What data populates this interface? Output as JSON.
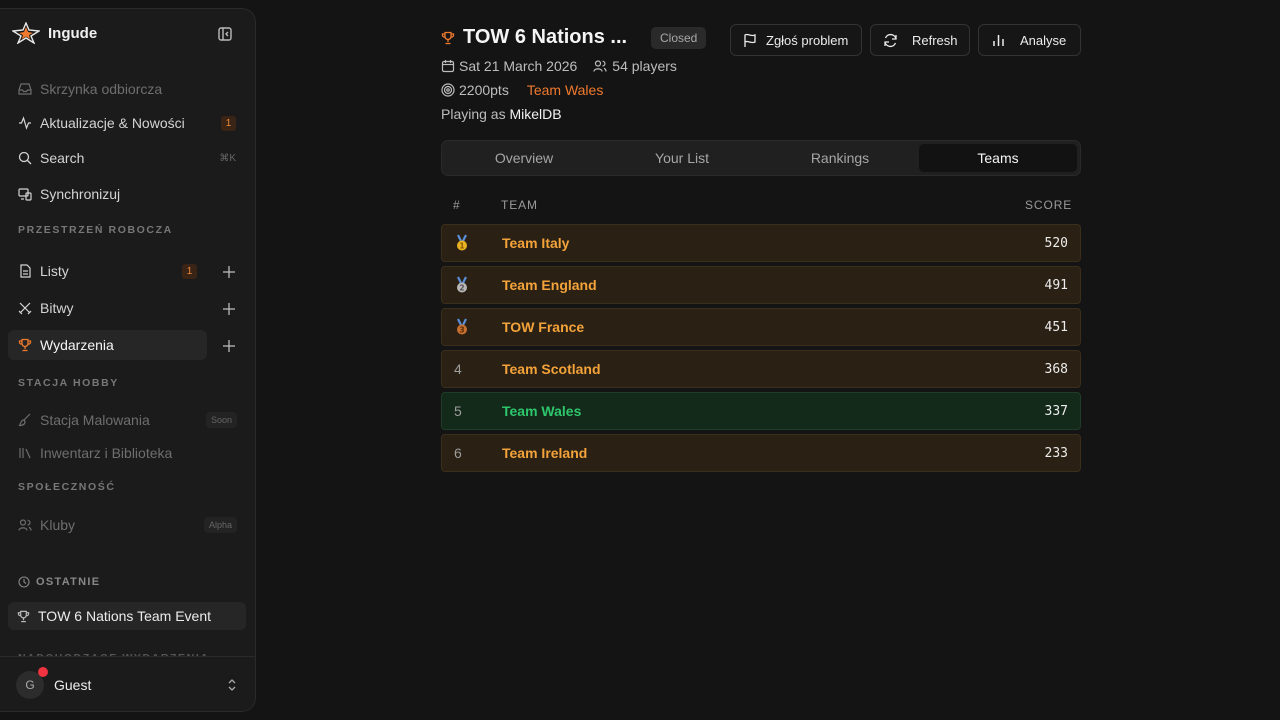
{
  "colors": {
    "accent": "#f07a2e",
    "gold": "#e8b323",
    "silver": "#b8b8b8",
    "bronze": "#c8702f",
    "highlight_team": "#2ec66b",
    "alert_dot": "#ef3340"
  },
  "sidebar": {
    "brand": "Ingude",
    "nav": [
      {
        "label": "Skrzynka odbiorcza",
        "icon": "inbox-icon"
      },
      {
        "label": "Aktualizacje & Nowości",
        "icon": "activity-icon",
        "badge": "1"
      },
      {
        "label": "Search",
        "icon": "search-icon",
        "shortcut": "⌘K"
      },
      {
        "label": "Synchronizuj",
        "icon": "devices-icon"
      }
    ],
    "workspace_label": "PRZESTRZEŃ ROBOCZA",
    "workspace": [
      {
        "label": "Listy",
        "icon": "list-icon",
        "badge": "1"
      },
      {
        "label": "Bitwy",
        "icon": "swords-icon"
      },
      {
        "label": "Wydarzenia",
        "icon": "trophy-icon"
      }
    ],
    "hobby_label": "STACJA HOBBY",
    "hobby": [
      {
        "label": "Stacja Malowania",
        "icon": "brush-icon",
        "tag": "Soon"
      },
      {
        "label": "Inwentarz i Biblioteka",
        "icon": "library-icon"
      }
    ],
    "community_label": "SPOŁECZNOŚĆ",
    "community": [
      {
        "label": "Kluby",
        "icon": "users-icon",
        "tag": "Alpha"
      }
    ],
    "recent_label": "OSTATNIE",
    "recent": [
      {
        "label": "TOW 6 Nations Team Event",
        "icon": "trophy-icon"
      }
    ],
    "upcoming_label": "NADCHODZĄCE WYDARZENIA",
    "user": {
      "initial": "G",
      "name": "Guest"
    }
  },
  "event": {
    "title": "TOW 6 Nations ...",
    "status": "Closed",
    "date": "Sat 21 March 2026",
    "players": "54 players",
    "points": "2200pts",
    "team": "Team Wales",
    "playing_prefix": "Playing as",
    "player": "MikelDB"
  },
  "actions": {
    "report": "Zgłoś problem",
    "refresh": "Refresh",
    "analyse": "Analyse"
  },
  "tabs": [
    "Overview",
    "Your List",
    "Rankings",
    "Teams"
  ],
  "active_tab": "Teams",
  "table": {
    "headers": {
      "rank": "#",
      "team": "TEAM",
      "score": "SCORE"
    },
    "rows": [
      {
        "rank": "1",
        "medal": "gold",
        "team": "Team Italy",
        "score": "520"
      },
      {
        "rank": "2",
        "medal": "silver",
        "team": "Team England",
        "score": "491"
      },
      {
        "rank": "3",
        "medal": "bronze",
        "team": "TOW France",
        "score": "451"
      },
      {
        "rank": "4",
        "team": "Team Scotland",
        "score": "368"
      },
      {
        "rank": "5",
        "team": "Team Wales",
        "score": "337",
        "mine": true
      },
      {
        "rank": "6",
        "team": "Team Ireland",
        "score": "233"
      }
    ]
  }
}
